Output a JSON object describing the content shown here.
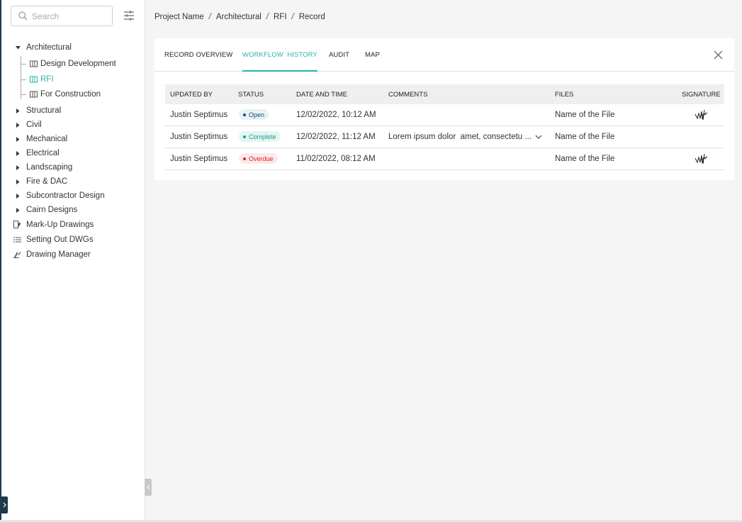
{
  "sidebar": {
    "search_placeholder": "Search",
    "tree": {
      "architectural": "Architectural",
      "children": [
        {
          "label": "Design Development"
        },
        {
          "label": "RFI"
        },
        {
          "label": "For Construction"
        }
      ],
      "groups": [
        {
          "label": "Structural"
        },
        {
          "label": "Civil"
        },
        {
          "label": "Mechanical"
        },
        {
          "label": "Electrical"
        },
        {
          "label": "Landscaping"
        },
        {
          "label": "Fire & DAC"
        },
        {
          "label": "Subcontractor Design"
        },
        {
          "label": "Cairn Designs"
        }
      ],
      "tools": [
        {
          "label": "Mark-Up Drawings",
          "icon": "markup-icon"
        },
        {
          "label": "Setting Out DWGs",
          "icon": "list-icon"
        },
        {
          "label": "Drawing Manager",
          "icon": "drawing-manager-icon"
        }
      ]
    }
  },
  "breadcrumb": [
    "Project Name",
    "Architectural",
    "RFI",
    "Record"
  ],
  "breadcrumb_separator": "/",
  "tabs": [
    {
      "label": "RECORD OVERVIEW"
    },
    {
      "label": "WORKFLOW  HISTORY",
      "active": true
    },
    {
      "label": "AUDIT"
    },
    {
      "label": "MAP"
    }
  ],
  "table": {
    "headers": [
      "UPDATED BY",
      "STATUS",
      "DATE AND TIME",
      "COMMENTS",
      "FILES",
      "SIGNATURE"
    ],
    "rows": [
      {
        "updated_by": "Justin Septimus",
        "status": "Open",
        "datetime": "12/02/2022, 10:12 AM",
        "comment": "",
        "file": "Name of the File",
        "signed": true
      },
      {
        "updated_by": "Justin Septimus",
        "status": "Complete",
        "datetime": "12/02/2022, 11:12 AM",
        "comment": "Lorem ipsum dolor  amet, consectetu ...",
        "file": "Name of the File",
        "signed": false
      },
      {
        "updated_by": "Justin Septimus",
        "status": "Overdue",
        "datetime": "11/02/2022, 08:12 AM",
        "comment": "",
        "file": "Name of the File",
        "signed": true
      }
    ]
  },
  "colors": {
    "accent": "#2bb3a8",
    "sidebar_dark": "#1d3b4a",
    "status_open": "#1d4f6a",
    "status_complete": "#1f9a86",
    "status_overdue": "#d9232e"
  }
}
